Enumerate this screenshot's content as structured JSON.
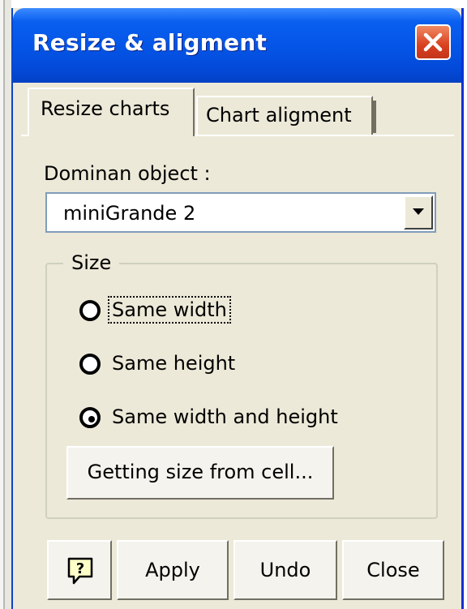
{
  "window": {
    "title": "Resize & aligment"
  },
  "tabs": [
    {
      "label": "Resize charts",
      "active": true
    },
    {
      "label": "Chart aligment",
      "active": false
    }
  ],
  "dominant": {
    "label": "Dominan object :",
    "selected": "miniGrande 2"
  },
  "size_group": {
    "legend": "Size",
    "options": [
      {
        "label": "Same width",
        "checked": false,
        "focused": true
      },
      {
        "label": "Same height",
        "checked": false,
        "focused": false
      },
      {
        "label": "Same width and height",
        "checked": true,
        "focused": false
      }
    ],
    "get_size_button": "Getting size from cell..."
  },
  "footer": {
    "help_icon": "help-icon",
    "apply_label": "Apply",
    "undo_label": "Undo",
    "close_label": "Close"
  },
  "colors": {
    "title_bar": "#0454e6",
    "close_button": "#d9401f",
    "dialog_face": "#ece9d8"
  }
}
